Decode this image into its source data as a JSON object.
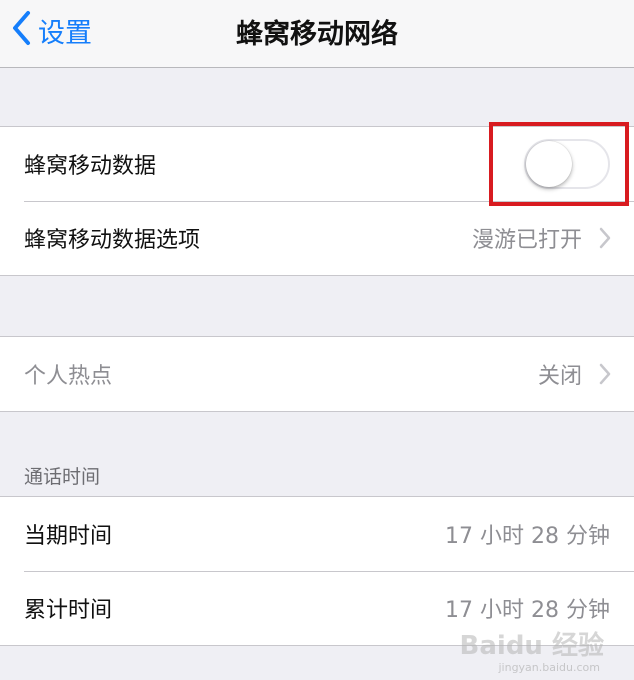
{
  "nav": {
    "back_label": "设置",
    "title": "蜂窝移动网络"
  },
  "cellular_group": {
    "data_label": "蜂窝移动数据",
    "data_enabled": false,
    "options_label": "蜂窝移动数据选项",
    "options_value": "漫游已打开"
  },
  "hotspot_group": {
    "label": "个人热点",
    "value": "关闭"
  },
  "call_time": {
    "header": "通话时间",
    "current_label": "当期时间",
    "current_value": "17 小时 28 分钟",
    "total_label": "累计时间",
    "total_value": "17 小时 28 分钟"
  },
  "watermark": {
    "text": "Baidu 经验",
    "sub": "jingyan.baidu.com"
  },
  "colors": {
    "accent": "#157efb",
    "highlight": "#d81b20"
  }
}
